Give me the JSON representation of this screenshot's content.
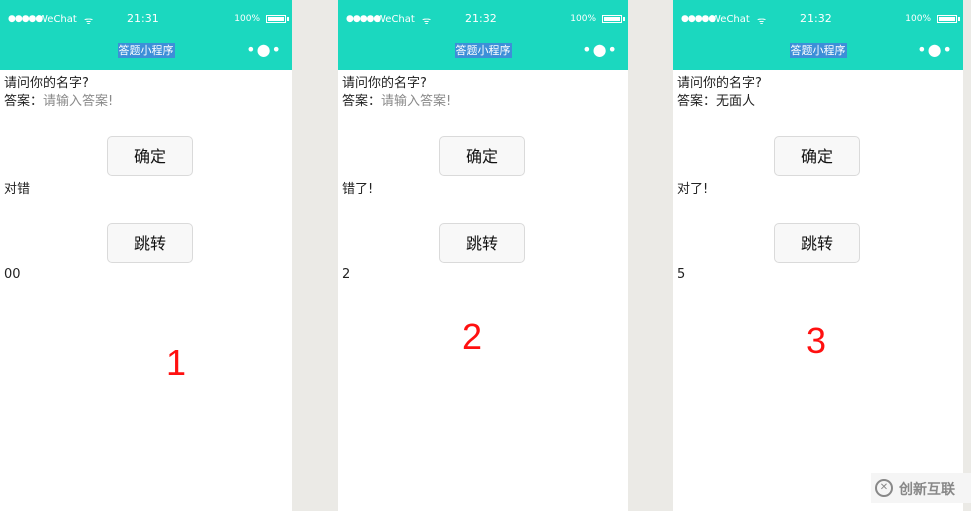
{
  "status_bar": {
    "signal": "●●●●●",
    "carrier": "WeChat",
    "wifi_icon": "wifi-icon",
    "battery": "100%"
  },
  "navbar": {
    "title": "答题小程序",
    "more": "•●•"
  },
  "screens": [
    {
      "time": "21:31",
      "question": "请问你的名字?",
      "answer_label": "答案：",
      "answer_value": "",
      "answer_placeholder": "请输入答案!",
      "confirm_label": "确定",
      "result": "对错",
      "jump_label": "跳转",
      "counter": "00",
      "step": "1"
    },
    {
      "time": "21:32",
      "question": "请问你的名字?",
      "answer_label": "答案：",
      "answer_value": "",
      "answer_placeholder": "请输入答案!",
      "confirm_label": "确定",
      "result": "错了!",
      "jump_label": "跳转",
      "counter": "2",
      "step": "2"
    },
    {
      "time": "21:32",
      "question": "请问你的名字?",
      "answer_label": "答案：",
      "answer_value": "无面人",
      "answer_placeholder": "",
      "confirm_label": "确定",
      "result": "对了!",
      "jump_label": "跳转",
      "counter": "5",
      "step": "3"
    }
  ],
  "watermark": {
    "logo": "✕",
    "text": "创新互联"
  },
  "colors": {
    "navbar": "#1bd8bf",
    "background": "#ebeae6",
    "step_number": "#ff1010"
  }
}
